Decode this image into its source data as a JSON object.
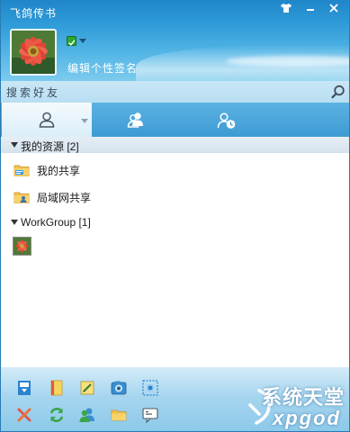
{
  "window": {
    "title": "飞鸽传书",
    "skin_glyph": "👕",
    "min_glyph": "—",
    "close_glyph": "✕"
  },
  "profile": {
    "avatar": "flower-photo",
    "status": "online",
    "signature": "编辑个性签名"
  },
  "search": {
    "text": "搜索好友",
    "icon": "search-icon"
  },
  "tabs": [
    {
      "name": "contacts",
      "icon": "person-icon",
      "active": true
    },
    {
      "name": "groups",
      "icon": "group-icon",
      "active": false
    },
    {
      "name": "recent",
      "icon": "clock-person-icon",
      "active": false
    }
  ],
  "groups": [
    {
      "label": "我的资源 [2]",
      "items": [
        {
          "label": "我的共享",
          "icon": "shared-folder-icon"
        },
        {
          "label": "局域网共享",
          "icon": "lan-folder-icon"
        }
      ]
    },
    {
      "label": "WorkGroup [1]",
      "items": [
        {
          "label": "",
          "icon": "flower-avatar"
        }
      ]
    }
  ],
  "toolbar": {
    "row1": [
      "import-icon",
      "notebook-icon",
      "edit-note-icon",
      "screenshot-icon",
      "scan-icon"
    ],
    "row2": [
      "tools-icon",
      "refresh-icon",
      "users-icon",
      "folder-icon",
      "message-icon"
    ]
  },
  "watermark": {
    "cn": "系统天堂",
    "en": "xpgod"
  },
  "colors": {
    "titlebar": "#1f86c9",
    "header_light": "#7ccbee",
    "search_bg": "#c9e7f6",
    "tab_bar": "#3d9bd3",
    "group_header": "#dfe8f0",
    "toolbar_bg": "#a7d6ef"
  }
}
